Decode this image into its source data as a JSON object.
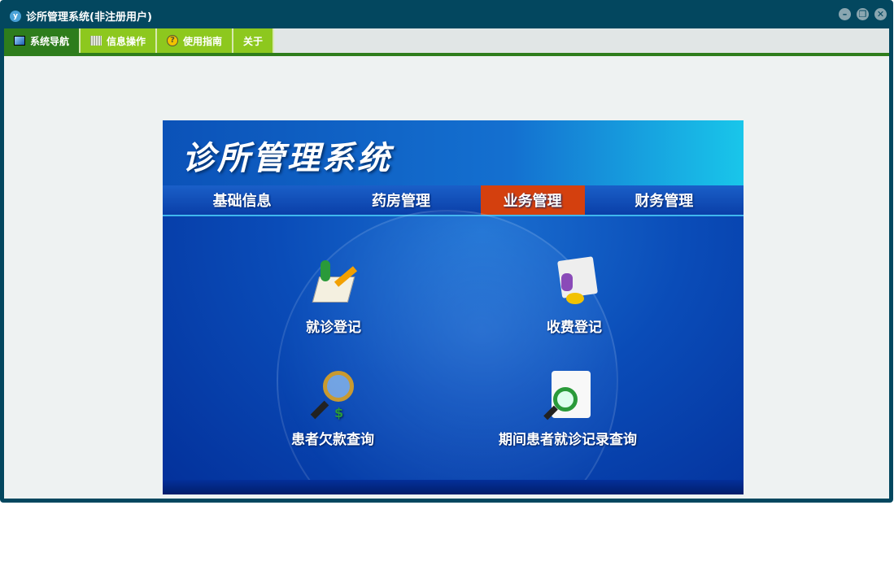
{
  "window": {
    "title": "诊所管理系统(非注册用户)"
  },
  "menu": [
    {
      "label": "系统导航",
      "icon": "monitor-icon"
    },
    {
      "label": "信息操作",
      "icon": "grid-icon"
    },
    {
      "label": "使用指南",
      "icon": "help-icon"
    },
    {
      "label": "关于"
    }
  ],
  "banner": {
    "title": "诊所管理系统",
    "nav": [
      "基础信息",
      "药房管理",
      "业务管理",
      "财务管理"
    ],
    "active_nav": "业务管理",
    "items": [
      {
        "label": "就诊登记",
        "icon": "register-icon"
      },
      {
        "label": "收费登记",
        "icon": "payment-icon"
      },
      {
        "label": "患者欠款查询",
        "icon": "debt-search-icon"
      },
      {
        "label": "期间患者就诊记录查询",
        "icon": "record-search-icon"
      }
    ]
  },
  "colors": {
    "frame": "#03475f",
    "tab": "#8dc81e",
    "tab_active": "#2e7d1c",
    "nav_active": "#d4400e"
  }
}
